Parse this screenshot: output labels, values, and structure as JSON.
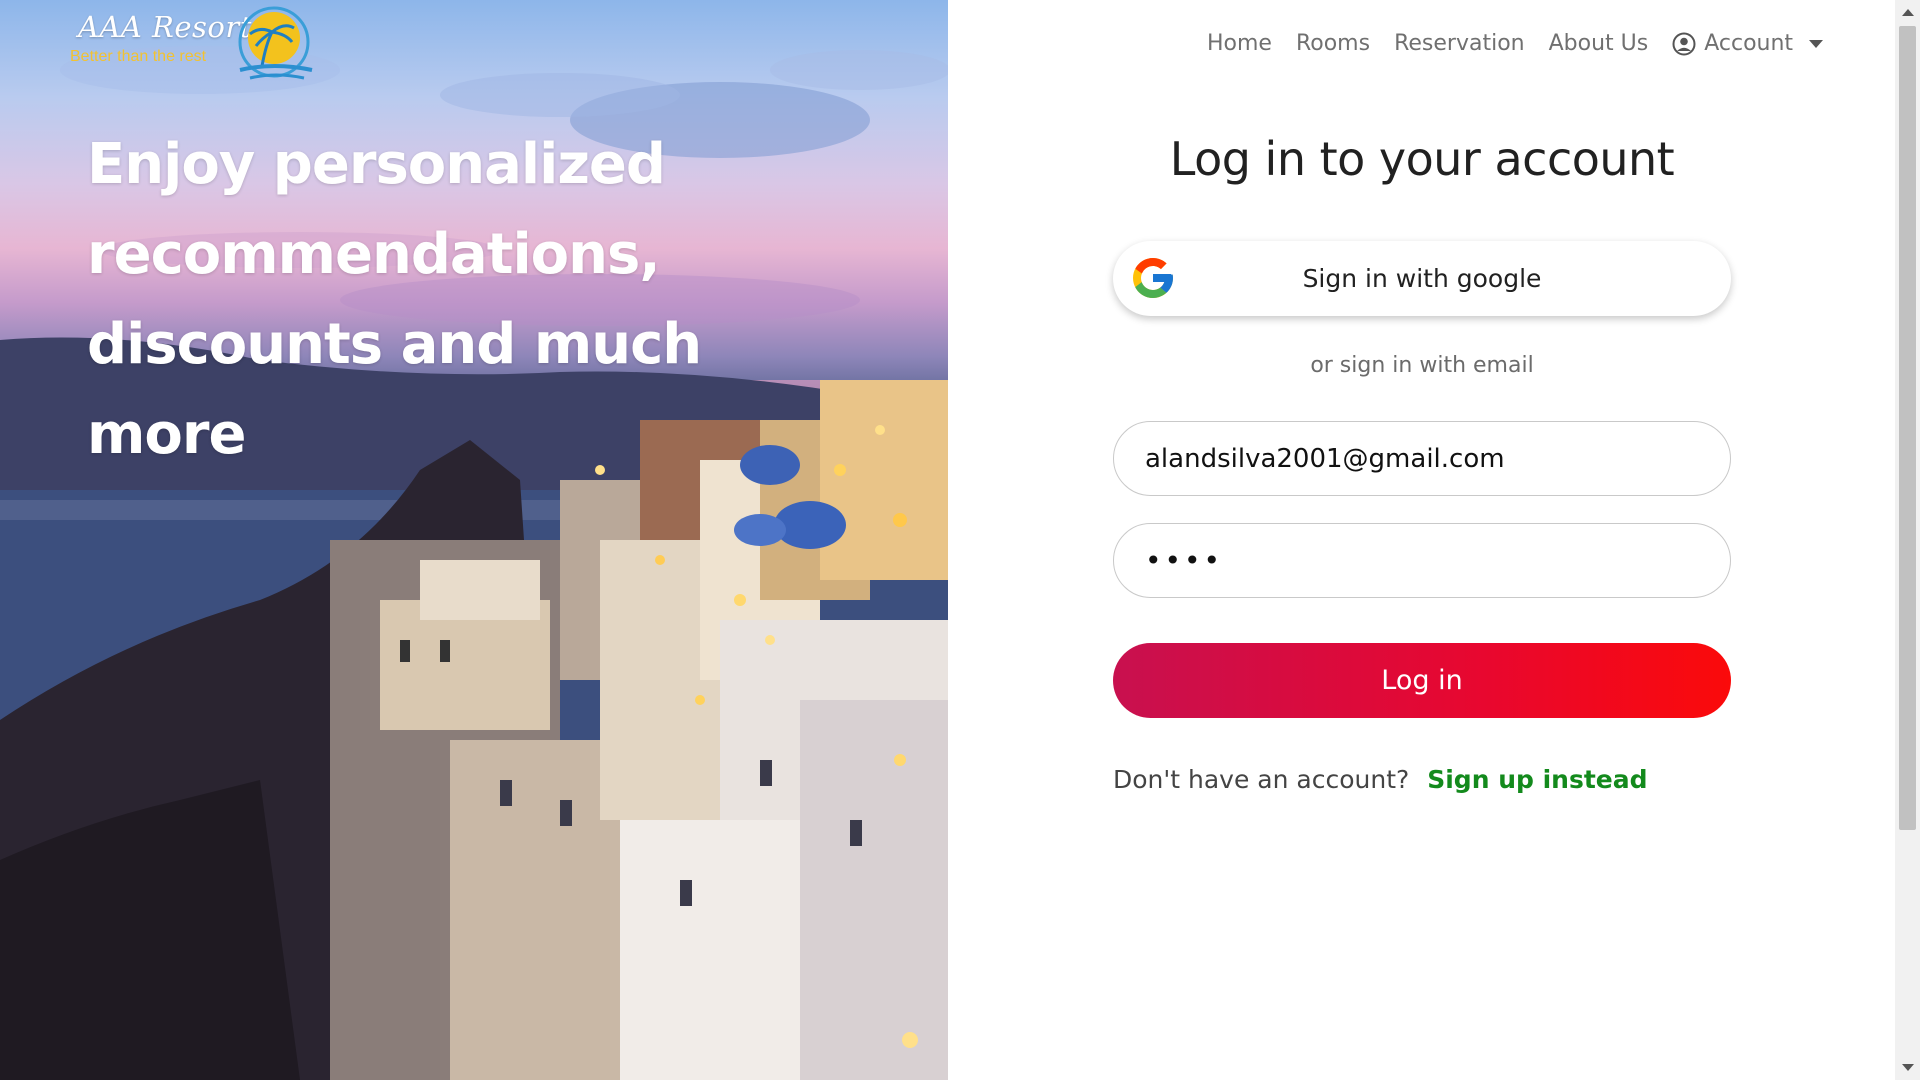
{
  "brand": {
    "name": "AAA Resorts",
    "tagline": "Better than the rest"
  },
  "hero": {
    "headline": "Enjoy personalized recommendations, discounts and much more"
  },
  "nav": {
    "items": [
      "Home",
      "Rooms",
      "Reservation",
      "About Us"
    ],
    "account_label": "Account"
  },
  "login": {
    "title": "Log in to your account",
    "google_button": "Sign in with google",
    "divider_text": "or sign in with email",
    "email_value": "alandsilva2001@gmail.com",
    "password_masked": "••••",
    "submit_label": "Log in",
    "signup_prompt": "Don't have an account?",
    "signup_link": "Sign up instead"
  },
  "colors": {
    "login_gradient_start": "#c8104f",
    "login_gradient_end": "#fb0a0a",
    "signup_link": "#138a1c",
    "logo_tagline": "#f2c230"
  },
  "icons": {
    "google": "google-g-icon",
    "account": "user-circle-icon",
    "dropdown": "caret-down-icon"
  }
}
